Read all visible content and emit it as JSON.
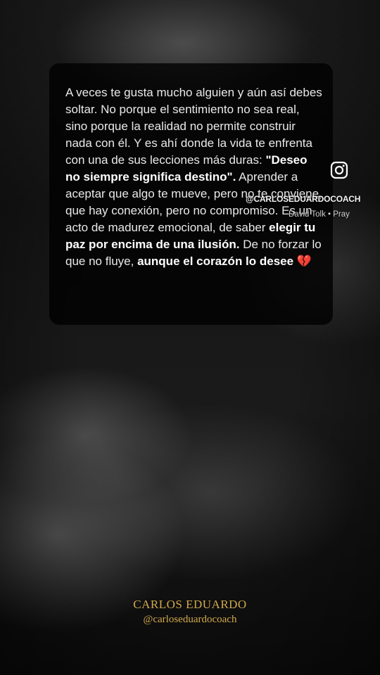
{
  "post": {
    "paragraph": [
      {
        "text": "A veces te gusta mucho alguien y aún así debes soltar. No porque el sentimiento no sea real, sino porque la realidad no permite construir nada con él. Y es ahí donde la vida te enfrenta con una de sus lecciones más duras: ",
        "bold": false
      },
      {
        "text": "\"Deseo no siempre significa destino\".",
        "bold": true
      },
      {
        "text": " Aprender a aceptar que algo te mueve, pero no te conviene, que hay conexión, pero no compromiso. Es un acto de madurez emocional, de saber ",
        "bold": false
      },
      {
        "text": "elegir tu paz por encima de una ilusión.",
        "bold": true
      },
      {
        "text": " De no forzar lo que no fluye, ",
        "bold": false
      },
      {
        "text": "aunque el corazón lo desee",
        "bold": true
      },
      {
        "text": " 💔",
        "bold": false
      }
    ]
  },
  "overlay": {
    "instagram_icon": "instagram-icon",
    "handle": "@CARLOSEDUARDOCOACH",
    "music": "David Tolk • Pray"
  },
  "signature": {
    "name": "CARLOS EDUARDO",
    "handle": "@carloseduardocoach",
    "color": "#d2a94d"
  }
}
